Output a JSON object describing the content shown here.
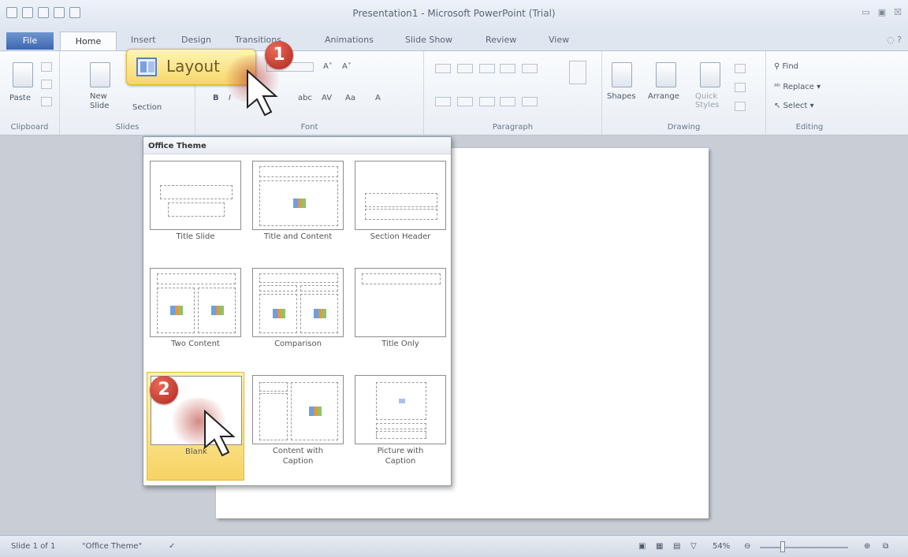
{
  "window": {
    "title": "Presentation1 - Microsoft PowerPoint (Trial)"
  },
  "tabs": [
    "File",
    "Home",
    "Insert",
    "Design",
    "Transitions",
    "Animations",
    "Slide Show",
    "Review",
    "View"
  ],
  "ribbon": {
    "clipboard": {
      "label": "Clipboard",
      "paste": "Paste"
    },
    "slides": {
      "label": "Slides",
      "new_slide": "New\nSlide",
      "layout": "Layout",
      "section": "Section"
    },
    "font": {
      "label": "Font",
      "bold": "B",
      "italic": "I"
    },
    "paragraph": {
      "label": "Paragraph"
    },
    "drawing": {
      "label": "Drawing",
      "shapes": "Shapes",
      "arrange": "Arrange",
      "quick_styles": "Quick\nStyles"
    },
    "editing": {
      "label": "Editing",
      "find": "Find",
      "replace": "Replace",
      "select": "Select"
    }
  },
  "callouts": {
    "step1": "1",
    "step2": "2"
  },
  "layout_gallery": {
    "header": "Office Theme",
    "items": [
      {
        "caption": "Title Slide"
      },
      {
        "caption": "Title and Content"
      },
      {
        "caption": "Section Header"
      },
      {
        "caption": "Two Content"
      },
      {
        "caption": "Comparison"
      },
      {
        "caption": "Title Only"
      },
      {
        "caption": "Blank"
      },
      {
        "caption": "Content with\nCaption"
      },
      {
        "caption": "Picture with\nCaption"
      }
    ]
  },
  "status": {
    "slide": "Slide 1 of 1",
    "theme": "\"Office Theme\"",
    "zoom": "54%"
  },
  "colors": {
    "accent": "#f6d66a",
    "badge": "#b1261f"
  }
}
